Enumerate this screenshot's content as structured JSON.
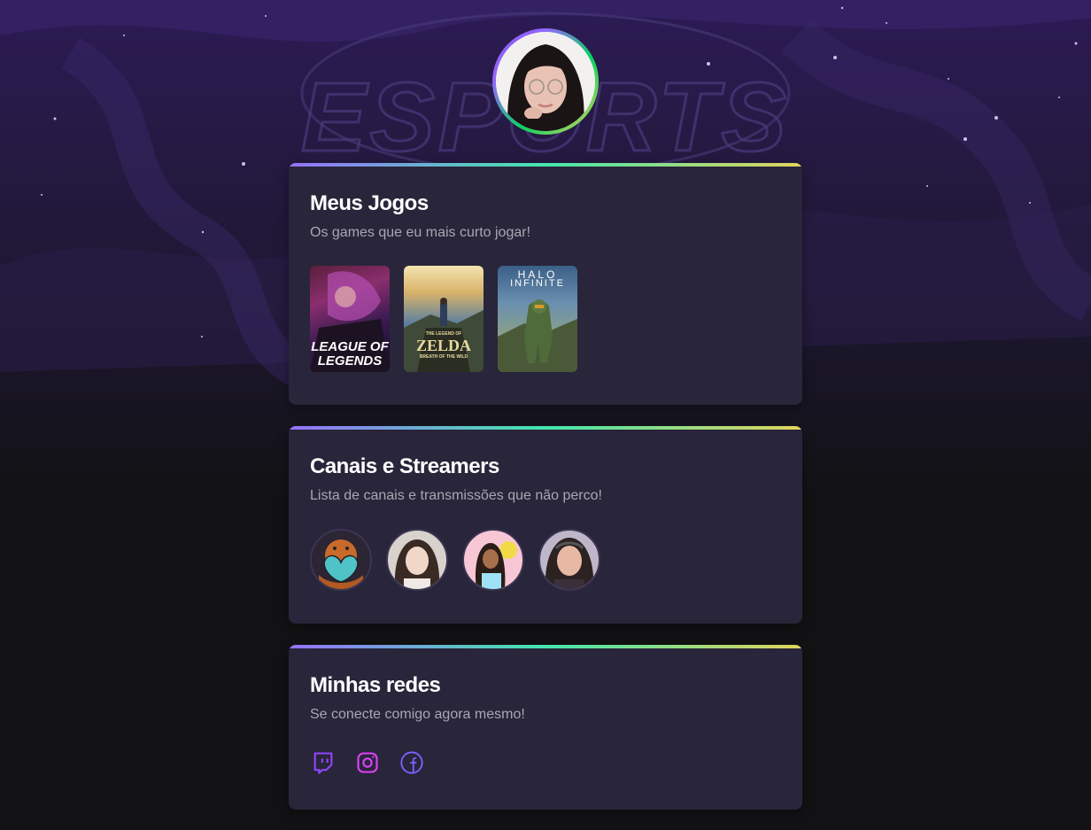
{
  "profile": {
    "avatar_alt": "profile-avatar"
  },
  "games_card": {
    "title": "Meus Jogos",
    "subtitle": "Os games que eu mais curto jogar!",
    "games": [
      {
        "line1": "LEAGUE OF",
        "line2": "LEGENDS"
      },
      {
        "line1": "THE LEGEND OF",
        "line2": "ZELDA",
        "line3": "BREATH OF THE WILD"
      },
      {
        "line1": "HALO",
        "line2": "INFINITE"
      }
    ]
  },
  "streamers_card": {
    "title": "Canais e Streamers",
    "subtitle": "Lista de canais e transmissões que não perco!"
  },
  "social_card": {
    "title": "Minhas redes",
    "subtitle": "Se conecte comigo agora mesmo!",
    "icons": [
      "twitch-icon",
      "instagram-icon",
      "facebook-icon"
    ]
  },
  "colors": {
    "accent_purple": "#8257e5",
    "accent_green": "#04d361",
    "accent_yellow": "#e1d55d",
    "card_bg": "#29253a",
    "page_bg": "#121214",
    "twitch": "#9146ff",
    "instagram": "#e040fb",
    "facebook": "#7b61ff"
  }
}
